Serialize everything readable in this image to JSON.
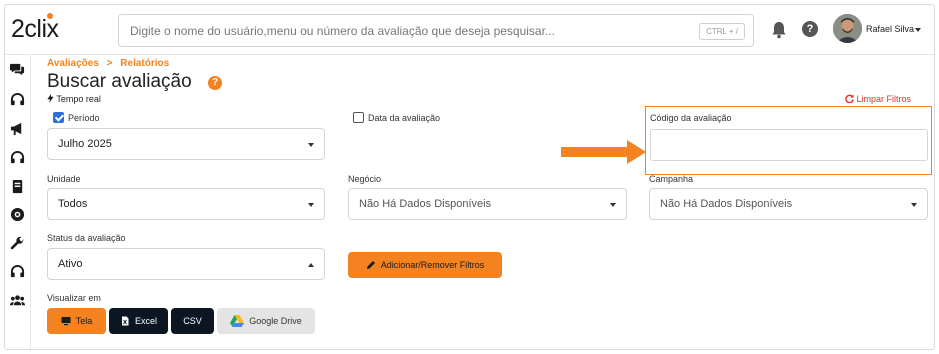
{
  "header": {
    "logo": "2clix",
    "search_placeholder": "Digite o nome do usuário,menu ou número da avaliação que deseja pesquisar...",
    "search_shortcut": "CTRL + /",
    "user_name": "Rafael Silva"
  },
  "sidebar": {
    "items": [
      "chat-icon",
      "headset-icon",
      "megaphone-icon",
      "headset-icon",
      "book-icon",
      "target-icon",
      "wrench-icon",
      "headset-icon",
      "users-icon"
    ]
  },
  "breadcrumb": {
    "level1": "Avaliações",
    "separator": ">",
    "level2": "Relatórios"
  },
  "page": {
    "title": "Buscar avaliação",
    "realtime": "Tempo real",
    "clear_filters": "Limpar Filtros"
  },
  "filters": {
    "periodo": {
      "label": "Período",
      "checked": true,
      "value": "Julho 2025"
    },
    "data_avaliacao": {
      "label": "Data da avaliação",
      "checked": false
    },
    "codigo": {
      "label": "Código da avaliação",
      "value": ""
    },
    "unidade": {
      "label": "Unidade",
      "value": "Todos"
    },
    "negocio": {
      "label": "Negócio",
      "value": "Não Há Dados Disponíveis"
    },
    "campanha": {
      "label": "Campanha",
      "value": "Não Há Dados Disponíveis"
    },
    "status": {
      "label": "Status da avaliação",
      "value": "Ativo"
    },
    "add_remove_button": "Adicionar/Remover Filtros"
  },
  "visualizar": {
    "label": "Visualizar em",
    "buttons": [
      "Tela",
      "Excel",
      "CSV",
      "Google Drive"
    ]
  },
  "colors": {
    "accent": "#f58220",
    "dark": "#0b1622",
    "danger": "#d9342b",
    "check": "#2f6fdd"
  }
}
